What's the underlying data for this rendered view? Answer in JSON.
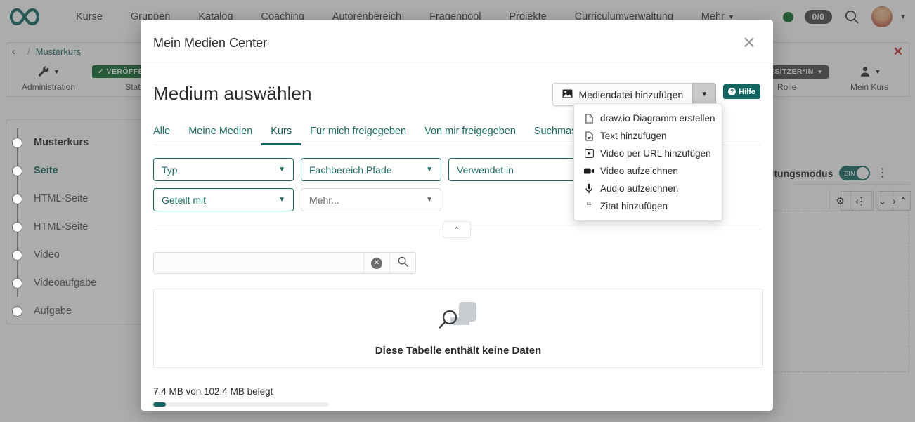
{
  "topnav": {
    "logo_icon": "infinity-logo",
    "items": [
      {
        "label": "Kurse"
      },
      {
        "label": "Gruppen"
      },
      {
        "label": "Katalog"
      },
      {
        "label": "Coaching"
      },
      {
        "label": "Autorenbereich"
      },
      {
        "label": "Fragenpool"
      },
      {
        "label": "Projekte"
      },
      {
        "label": "Curriculumverwaltung"
      },
      {
        "label": "Mehr"
      }
    ],
    "status_count": "0/0",
    "search_icon": "search-icon",
    "avatar_icon": "user-avatar"
  },
  "breadcrumb": {
    "back_icon": "chevron-left-icon",
    "separator": "/",
    "current": "Musterkurs",
    "close_icon": "close-icon"
  },
  "toolbar": {
    "admin_label": "Administration",
    "admin_icon": "wrench-icon",
    "status_badge": "VERÖFFENTLICHT",
    "status_label": "Status",
    "role_badge": "BESITZER*IN",
    "role_label": "Rolle",
    "owner_label": "Mein Kurs",
    "owner_icon": "person-icon"
  },
  "course_tree": {
    "items": [
      {
        "label": "Musterkurs",
        "style": "root"
      },
      {
        "label": "Seite",
        "style": "active"
      },
      {
        "label": "HTML-Seite",
        "style": "normal"
      },
      {
        "label": "HTML-Seite",
        "style": "normal"
      },
      {
        "label": "Video",
        "style": "normal"
      },
      {
        "label": "Videoaufgabe",
        "style": "normal"
      },
      {
        "label": "Aufgabe",
        "style": "normal"
      }
    ]
  },
  "edit_mode": {
    "label": "Bearbeitungsmodus",
    "toggle_state": "EIN",
    "kebab_icon": "kebab-menu-icon"
  },
  "pager": {
    "prev_icon": "chevron-left-icon",
    "next_icon": "chevron-right-icon"
  },
  "content_controls": {
    "gear_icon": "gear-icon",
    "kebab_icon": "kebab-menu-icon",
    "down_icon": "chevron-down-icon",
    "up_icon": "chevron-up-icon"
  },
  "modal": {
    "title": "Mein Medien Center",
    "close_icon": "close-icon",
    "heading": "Medium auswählen",
    "add_button": {
      "label": "Mediendatei hinzufügen",
      "icon": "image-icon",
      "caret_icon": "caret-down-icon"
    },
    "help_button": {
      "label": "Hilfe",
      "icon": "question-mark-icon"
    },
    "dropdown_menu": {
      "items": [
        {
          "label": "draw.io Diagramm erstellen",
          "icon": "file-icon"
        },
        {
          "label": "Text hinzufügen",
          "icon": "text-file-icon"
        },
        {
          "label": "Video per URL hinzufügen",
          "icon": "video-url-icon"
        },
        {
          "label": "Video aufzeichnen",
          "icon": "video-camera-icon"
        },
        {
          "label": "Audio aufzeichnen",
          "icon": "microphone-icon"
        },
        {
          "label": "Zitat hinzufügen",
          "icon": "quote-icon"
        }
      ]
    },
    "tabs": [
      {
        "label": "Alle",
        "active": false
      },
      {
        "label": "Meine Medien",
        "active": false
      },
      {
        "label": "Kurs",
        "active": true
      },
      {
        "label": "Für mich freigegeben",
        "active": false
      },
      {
        "label": "Von mir freigegeben",
        "active": false
      },
      {
        "label": "Suchmaske",
        "active": false
      }
    ],
    "filters": [
      {
        "label": "Typ",
        "style": "teal"
      },
      {
        "label": "Fachbereich Pfade",
        "style": "teal"
      },
      {
        "label": "Verwendet in",
        "style": "teal"
      },
      {
        "label": "Geteilt mit",
        "style": "teal"
      },
      {
        "label": "Mehr...",
        "style": "gray"
      }
    ],
    "collapse_icon": "chevron-up-icon",
    "search": {
      "value": "",
      "placeholder": "",
      "clear_icon": "clear-icon",
      "search_icon": "search-icon"
    },
    "empty_state": {
      "icon": "no-data-search-icon",
      "text": "Diese Tabelle enthält keine Daten"
    },
    "storage": {
      "text": "7.4 MB von 102.4 MB belegt",
      "percent": 7.2
    }
  },
  "colors": {
    "accent": "#11655e",
    "link": "#1a6b63",
    "published": "#0d6b2c",
    "danger": "#cc2b2b"
  }
}
